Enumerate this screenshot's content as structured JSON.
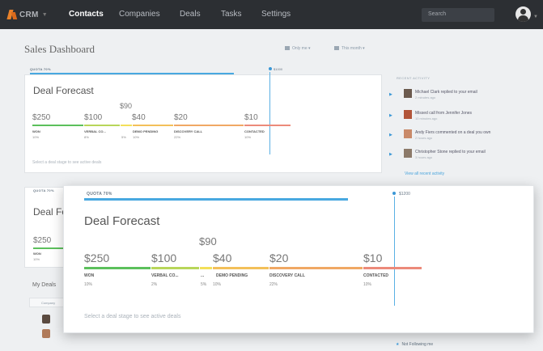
{
  "nav": {
    "logo": "CRM",
    "tabs": [
      "Contacts",
      "Companies",
      "Deals",
      "Tasks",
      "Settings"
    ],
    "active_tab": "Contacts",
    "search_placeholder": "Search"
  },
  "dashboard": {
    "title": "Sales Dashboard",
    "filter_owner": "Only me",
    "filter_period": "This month"
  },
  "forecast_back": {
    "quota_label": "QUOTA 70%",
    "target_label": "$1000",
    "title": "Deal Forecast",
    "mid_amount": "$90",
    "stages": [
      {
        "amount": "$250",
        "label": "WON",
        "pct": "10%",
        "color": "#5cc05c"
      },
      {
        "amount": "$100",
        "label": "VERBAL CO...",
        "pct": "8%",
        "color": "#b8d65a"
      },
      {
        "amount": "",
        "label": "...",
        "pct": "5%",
        "color": "#f3e05a"
      },
      {
        "amount": "$40",
        "label": "DEMO PENDING",
        "pct": "10%",
        "color": "#f3c05a"
      },
      {
        "amount": "$20",
        "label": "DISCOVERY CALL",
        "pct": "22%",
        "color": "#f0a864"
      },
      {
        "amount": "$10",
        "label": "CONTACTED",
        "pct": "10%",
        "color": "#ec8a7a"
      }
    ],
    "hint": "Select a deal stage to see active deals"
  },
  "forecast_fore": {
    "quota_label": "QUOTA 70%",
    "target_label": "$1200",
    "title": "Deal Forecast",
    "mid_amount": "$90",
    "stages": [
      {
        "amount": "$250",
        "label": "WON",
        "pct": "10%",
        "color": "#5cc05c"
      },
      {
        "amount": "$100",
        "label": "VERBAL CO...",
        "pct": "2%",
        "color": "#b8d65a"
      },
      {
        "amount": "",
        "label": "...",
        "pct": "5%",
        "color": "#f3e05a"
      },
      {
        "amount": "$40",
        "label": "DEMO PENDING",
        "pct": "10%",
        "color": "#f3c05a"
      },
      {
        "amount": "$20",
        "label": "DISCOVERY CALL",
        "pct": "22%",
        "color": "#f0a864"
      },
      {
        "amount": "$10",
        "label": "CONTACTED",
        "pct": "10%",
        "color": "#ec8a7a"
      }
    ],
    "hint": "Select a deal stage to see active deals"
  },
  "second_card": {
    "quota_label": "QUOTA 70%",
    "title": "Deal Fo",
    "amount": "$250",
    "stage_label": "WON",
    "pct": "10%"
  },
  "activity": {
    "heading": "RECENT ACTIVITY",
    "items": [
      {
        "text": "Michael Clark replied to your email",
        "time": "2 minutes ago",
        "color": "#6b5a4e"
      },
      {
        "text": "Missed call from Jennifer Jones",
        "time": "10 minutes ago",
        "color": "#b2553a"
      },
      {
        "text": "Andy Fiers commented on a deal you own",
        "time": "2 hours ago",
        "color": "#c98a6a"
      },
      {
        "text": "Christopher Stone replied to your email",
        "time": "3 hours ago",
        "color": "#8c7a6a"
      }
    ],
    "view_all": "View all recent activity"
  },
  "my_deals": {
    "title": "My Deals",
    "column": "Company"
  },
  "following": "Not Following me"
}
